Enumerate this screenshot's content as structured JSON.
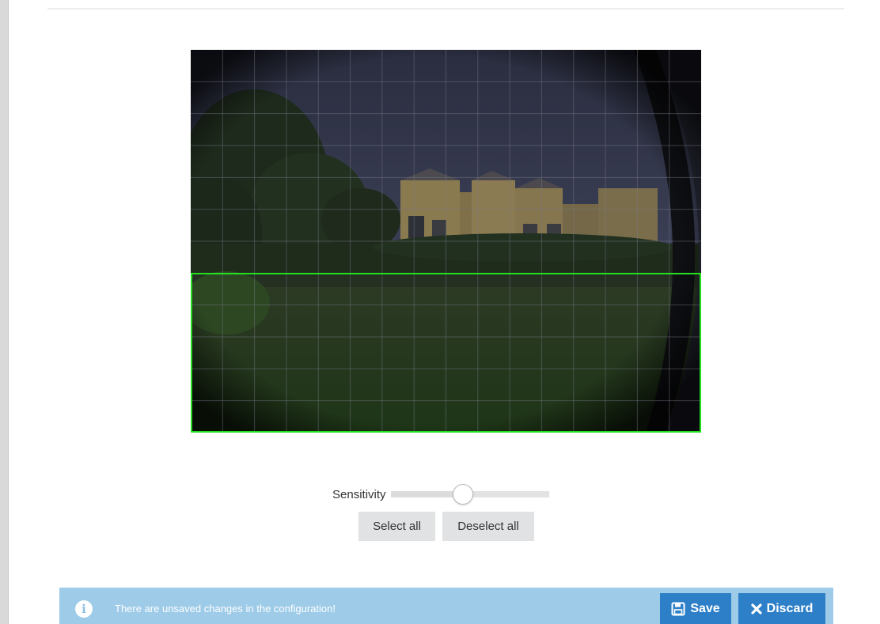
{
  "camera": {
    "grid_columns": 16,
    "grid_rows": 12,
    "selected_zone_rows": [
      7,
      11
    ]
  },
  "controls": {
    "sensitivity_label": "Sensitivity",
    "sensitivity_value": 0.45,
    "select_all_label": "Select all",
    "deselect_all_label": "Deselect all"
  },
  "notice": {
    "icon": "info-icon",
    "message": "There are unsaved changes in the configuration!",
    "save_label": "Save",
    "save_icon": "floppy-disk-icon",
    "discard_label": "Discard",
    "discard_icon": "close-icon"
  },
  "colors": {
    "zone_border": "#22e01e",
    "notice_bg": "#9dcbe8",
    "action_button": "#2d7fc8"
  }
}
